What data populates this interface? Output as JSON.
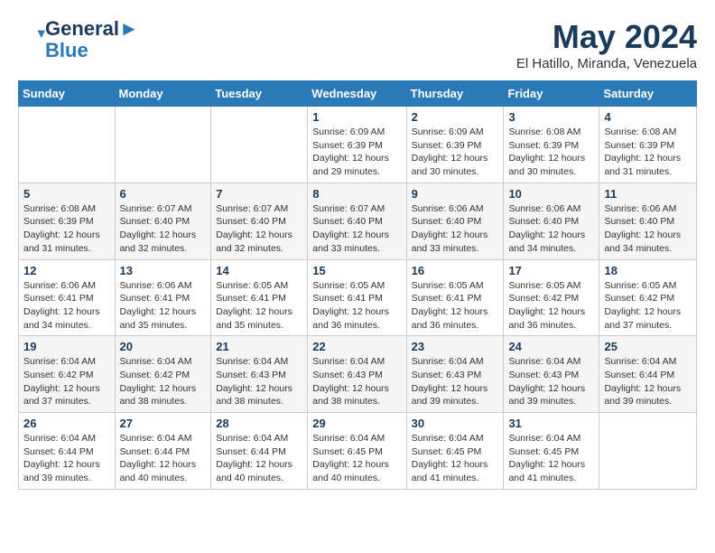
{
  "logo": {
    "line1": "General",
    "line2": "Blue"
  },
  "title": "May 2024",
  "location": "El Hatillo, Miranda, Venezuela",
  "days_of_week": [
    "Sunday",
    "Monday",
    "Tuesday",
    "Wednesday",
    "Thursday",
    "Friday",
    "Saturday"
  ],
  "weeks": [
    [
      {
        "day": "",
        "sunrise": "",
        "sunset": "",
        "daylight": ""
      },
      {
        "day": "",
        "sunrise": "",
        "sunset": "",
        "daylight": ""
      },
      {
        "day": "",
        "sunrise": "",
        "sunset": "",
        "daylight": ""
      },
      {
        "day": "1",
        "sunrise": "Sunrise: 6:09 AM",
        "sunset": "Sunset: 6:39 PM",
        "daylight": "Daylight: 12 hours and 29 minutes."
      },
      {
        "day": "2",
        "sunrise": "Sunrise: 6:09 AM",
        "sunset": "Sunset: 6:39 PM",
        "daylight": "Daylight: 12 hours and 30 minutes."
      },
      {
        "day": "3",
        "sunrise": "Sunrise: 6:08 AM",
        "sunset": "Sunset: 6:39 PM",
        "daylight": "Daylight: 12 hours and 30 minutes."
      },
      {
        "day": "4",
        "sunrise": "Sunrise: 6:08 AM",
        "sunset": "Sunset: 6:39 PM",
        "daylight": "Daylight: 12 hours and 31 minutes."
      }
    ],
    [
      {
        "day": "5",
        "sunrise": "Sunrise: 6:08 AM",
        "sunset": "Sunset: 6:39 PM",
        "daylight": "Daylight: 12 hours and 31 minutes."
      },
      {
        "day": "6",
        "sunrise": "Sunrise: 6:07 AM",
        "sunset": "Sunset: 6:40 PM",
        "daylight": "Daylight: 12 hours and 32 minutes."
      },
      {
        "day": "7",
        "sunrise": "Sunrise: 6:07 AM",
        "sunset": "Sunset: 6:40 PM",
        "daylight": "Daylight: 12 hours and 32 minutes."
      },
      {
        "day": "8",
        "sunrise": "Sunrise: 6:07 AM",
        "sunset": "Sunset: 6:40 PM",
        "daylight": "Daylight: 12 hours and 33 minutes."
      },
      {
        "day": "9",
        "sunrise": "Sunrise: 6:06 AM",
        "sunset": "Sunset: 6:40 PM",
        "daylight": "Daylight: 12 hours and 33 minutes."
      },
      {
        "day": "10",
        "sunrise": "Sunrise: 6:06 AM",
        "sunset": "Sunset: 6:40 PM",
        "daylight": "Daylight: 12 hours and 34 minutes."
      },
      {
        "day": "11",
        "sunrise": "Sunrise: 6:06 AM",
        "sunset": "Sunset: 6:40 PM",
        "daylight": "Daylight: 12 hours and 34 minutes."
      }
    ],
    [
      {
        "day": "12",
        "sunrise": "Sunrise: 6:06 AM",
        "sunset": "Sunset: 6:41 PM",
        "daylight": "Daylight: 12 hours and 34 minutes."
      },
      {
        "day": "13",
        "sunrise": "Sunrise: 6:06 AM",
        "sunset": "Sunset: 6:41 PM",
        "daylight": "Daylight: 12 hours and 35 minutes."
      },
      {
        "day": "14",
        "sunrise": "Sunrise: 6:05 AM",
        "sunset": "Sunset: 6:41 PM",
        "daylight": "Daylight: 12 hours and 35 minutes."
      },
      {
        "day": "15",
        "sunrise": "Sunrise: 6:05 AM",
        "sunset": "Sunset: 6:41 PM",
        "daylight": "Daylight: 12 hours and 36 minutes."
      },
      {
        "day": "16",
        "sunrise": "Sunrise: 6:05 AM",
        "sunset": "Sunset: 6:41 PM",
        "daylight": "Daylight: 12 hours and 36 minutes."
      },
      {
        "day": "17",
        "sunrise": "Sunrise: 6:05 AM",
        "sunset": "Sunset: 6:42 PM",
        "daylight": "Daylight: 12 hours and 36 minutes."
      },
      {
        "day": "18",
        "sunrise": "Sunrise: 6:05 AM",
        "sunset": "Sunset: 6:42 PM",
        "daylight": "Daylight: 12 hours and 37 minutes."
      }
    ],
    [
      {
        "day": "19",
        "sunrise": "Sunrise: 6:04 AM",
        "sunset": "Sunset: 6:42 PM",
        "daylight": "Daylight: 12 hours and 37 minutes."
      },
      {
        "day": "20",
        "sunrise": "Sunrise: 6:04 AM",
        "sunset": "Sunset: 6:42 PM",
        "daylight": "Daylight: 12 hours and 38 minutes."
      },
      {
        "day": "21",
        "sunrise": "Sunrise: 6:04 AM",
        "sunset": "Sunset: 6:43 PM",
        "daylight": "Daylight: 12 hours and 38 minutes."
      },
      {
        "day": "22",
        "sunrise": "Sunrise: 6:04 AM",
        "sunset": "Sunset: 6:43 PM",
        "daylight": "Daylight: 12 hours and 38 minutes."
      },
      {
        "day": "23",
        "sunrise": "Sunrise: 6:04 AM",
        "sunset": "Sunset: 6:43 PM",
        "daylight": "Daylight: 12 hours and 39 minutes."
      },
      {
        "day": "24",
        "sunrise": "Sunrise: 6:04 AM",
        "sunset": "Sunset: 6:43 PM",
        "daylight": "Daylight: 12 hours and 39 minutes."
      },
      {
        "day": "25",
        "sunrise": "Sunrise: 6:04 AM",
        "sunset": "Sunset: 6:44 PM",
        "daylight": "Daylight: 12 hours and 39 minutes."
      }
    ],
    [
      {
        "day": "26",
        "sunrise": "Sunrise: 6:04 AM",
        "sunset": "Sunset: 6:44 PM",
        "daylight": "Daylight: 12 hours and 39 minutes."
      },
      {
        "day": "27",
        "sunrise": "Sunrise: 6:04 AM",
        "sunset": "Sunset: 6:44 PM",
        "daylight": "Daylight: 12 hours and 40 minutes."
      },
      {
        "day": "28",
        "sunrise": "Sunrise: 6:04 AM",
        "sunset": "Sunset: 6:44 PM",
        "daylight": "Daylight: 12 hours and 40 minutes."
      },
      {
        "day": "29",
        "sunrise": "Sunrise: 6:04 AM",
        "sunset": "Sunset: 6:45 PM",
        "daylight": "Daylight: 12 hours and 40 minutes."
      },
      {
        "day": "30",
        "sunrise": "Sunrise: 6:04 AM",
        "sunset": "Sunset: 6:45 PM",
        "daylight": "Daylight: 12 hours and 41 minutes."
      },
      {
        "day": "31",
        "sunrise": "Sunrise: 6:04 AM",
        "sunset": "Sunset: 6:45 PM",
        "daylight": "Daylight: 12 hours and 41 minutes."
      },
      {
        "day": "",
        "sunrise": "",
        "sunset": "",
        "daylight": ""
      }
    ]
  ]
}
